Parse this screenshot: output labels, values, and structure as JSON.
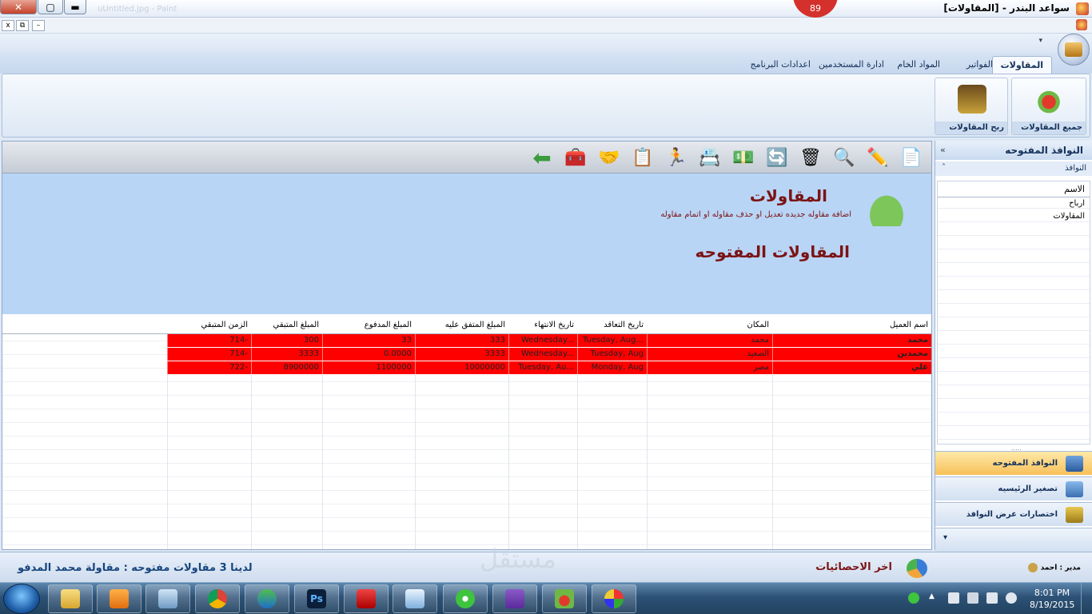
{
  "window": {
    "title": "سواعد البندر - [المقاولات]",
    "badge": "89",
    "faint_title": "uUntitled.jpg - Paint"
  },
  "mdi": {
    "close": "x",
    "restore": "⧉",
    "minimize": "–"
  },
  "ribbon": {
    "tabs": [
      "المقاولات",
      "الفواتير",
      "المواد الخام",
      "ادارة المستخدمين",
      "اعدادات البرنامج"
    ],
    "groups": [
      {
        "label": "جميع المقاولات",
        "icon": "house-icon"
      },
      {
        "label": "ربح المقاولات",
        "icon": "treasure-chest-icon"
      }
    ]
  },
  "right_pane": {
    "title": "النوافذ المفتوحه",
    "subtitle": "النوافذ",
    "list_header": "الاسم",
    "items": [
      "ارباح",
      "المقاولات"
    ],
    "nav": [
      {
        "label": "النوافذ المفتوحه",
        "active": true
      },
      {
        "label": "تصغير الرئيسيه",
        "active": false
      },
      {
        "label": "اختصارات عرض النوافذ",
        "active": false
      }
    ]
  },
  "toolbar": {
    "icons": [
      "new-page-icon",
      "edit-pencil-icon",
      "search-magnifier-icon",
      "recycle-bin-icon",
      "refresh-icon",
      "money-icon",
      "contacts-book-icon",
      "person-running-icon",
      "checklist-icon",
      "handshake-icon",
      "treasure-chest-icon",
      "back-arrow-icon"
    ]
  },
  "header": {
    "title": "المقاولات",
    "subtitle": "اضافة مقاوله جديده تعديل او حذف مقاوله او اتمام مقاوله",
    "section_title": "المقاولات المفتوحه"
  },
  "grid": {
    "columns": [
      "اسم العميل",
      "المكان",
      "تاريخ التعاقد",
      "تاريخ الانتهاء",
      "المبلغ المتفق عليه",
      "المبلغ المدفوع",
      "المبلغ المتبقي",
      "الزمن المتبقي"
    ],
    "rows": [
      [
        "محمد",
        "محمد",
        "Tuesday, Aug...",
        "Wednesday...",
        "333",
        "33",
        "300",
        "714-"
      ],
      [
        "محمدين",
        "الصعيد",
        "Tuesday, Aug",
        "Wednesday...",
        "3333",
        "0.0000",
        "3333",
        "714-"
      ],
      [
        "علي",
        "مصر",
        "Monday, Aug",
        "Tuesday, Au...",
        "10000000",
        "1100000",
        "8900000",
        "722-"
      ]
    ],
    "row_color": "#ff0000"
  },
  "status": {
    "left_text": "لدينا   3 مقاولات مفتوحه   :   مقاولة محمد المدفو",
    "stats_label": "اخر الاحصائيات",
    "user_text": "مدير : احمد"
  },
  "watermark": "مستقل",
  "taskbar": {
    "apps": [
      "file-explorer-icon",
      "media-player-icon",
      "snipping-tool-icon",
      "chrome-icon",
      "download-manager-icon",
      "photoshop-icon",
      "network-tool-icon",
      "notepad-icon",
      "wifi-hotspot-icon",
      "visual-studio-icon",
      "house-icon",
      "paint-icon"
    ],
    "ps_label": "Ps",
    "time": "8:01 PM",
    "date": "8/19/2015"
  }
}
